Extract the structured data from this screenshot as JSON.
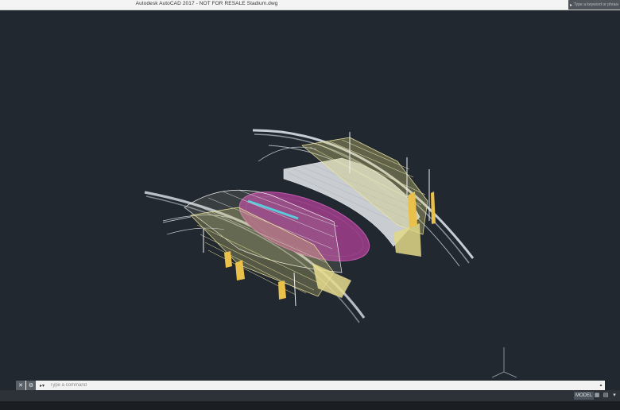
{
  "window": {
    "title": "Autodesk AutoCAD 2017 - NOT FOR RESALE    Stadium.dwg"
  },
  "search": {
    "placeholder": "Type a keyword or phrase"
  },
  "command_line": {
    "placeholder": "Type a command",
    "close_icon": "close-icon",
    "settings_icon": "wrench-icon",
    "prompt_icon": "command-prompt-icon"
  },
  "status_bar": {
    "model_label": "MODEL",
    "grid_icon": "grid-icon",
    "snap_icon": "snap-icon",
    "menu_icon": "chevron-down-icon"
  },
  "colors": {
    "viewport_background": "#212830",
    "field_fill": "#8e3a7f",
    "running_lane": "#49c7e0",
    "wire_yellow": "#e8e09a",
    "structure_gray": "#9aa0a8"
  }
}
